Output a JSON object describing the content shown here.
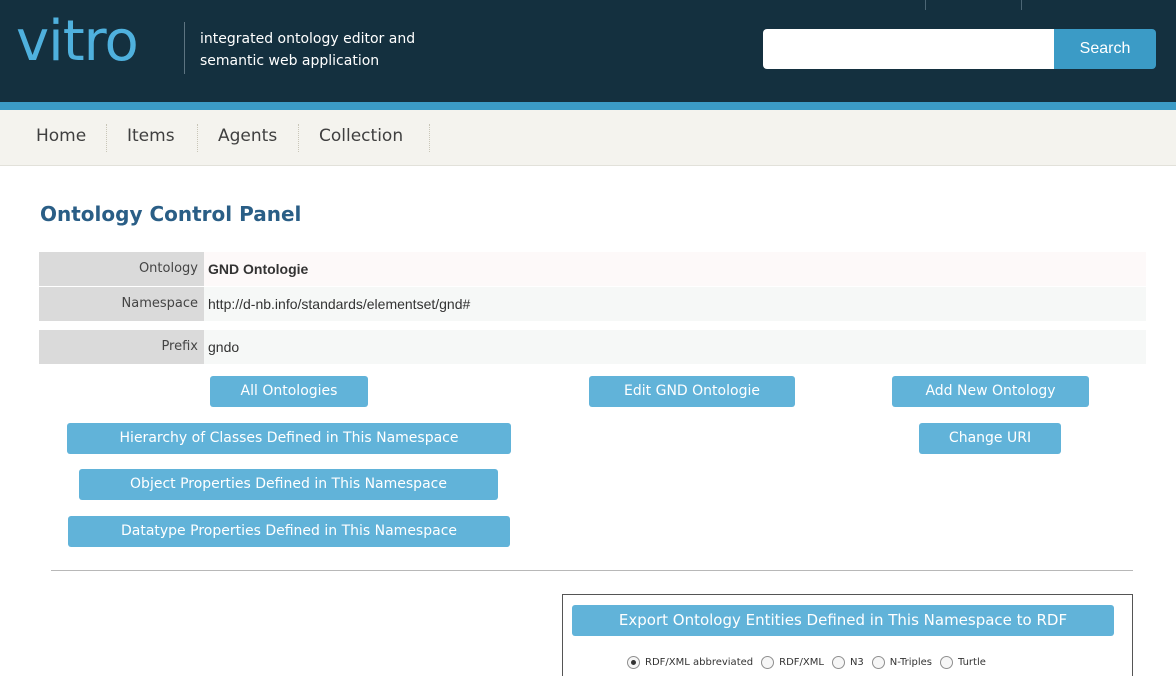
{
  "header": {
    "logo": "vitro",
    "tagline_line1": "integrated ontology editor and",
    "tagline_line2": "semantic web application",
    "search_value": "",
    "search_button": "Search"
  },
  "nav": {
    "items": [
      "Home",
      "Items",
      "Agents",
      "Collection"
    ]
  },
  "page": {
    "title": "Ontology Control Panel"
  },
  "ontology": {
    "rows": [
      {
        "label": "Ontology",
        "value": "GND Ontologie"
      },
      {
        "label": "Namespace",
        "value": "http://d-nb.info/standards/elementset/gnd#"
      },
      {
        "label": "Prefix",
        "value": "gndo"
      }
    ]
  },
  "actions": {
    "all_ontologies": "All Ontologies",
    "edit_ontology": "Edit GND Ontologie",
    "add_ontology": "Add New Ontology",
    "class_hierarchy": "Hierarchy of Classes Defined in This Namespace",
    "change_uri": "Change URI",
    "object_properties": "Object Properties Defined in This Namespace",
    "datatype_properties": "Datatype Properties Defined in This Namespace"
  },
  "export": {
    "button": "Export Ontology Entities Defined in This Namespace to RDF",
    "formats": [
      {
        "label": "RDF/XML abbreviated",
        "checked": true
      },
      {
        "label": "RDF/XML",
        "checked": false
      },
      {
        "label": "N3",
        "checked": false
      },
      {
        "label": "N-Triples",
        "checked": false
      },
      {
        "label": "Turtle",
        "checked": false
      }
    ]
  },
  "colors": {
    "header_bg": "#14303f",
    "accent": "#3b9bc6",
    "button": "#61b3d9",
    "title": "#2a5e86"
  }
}
